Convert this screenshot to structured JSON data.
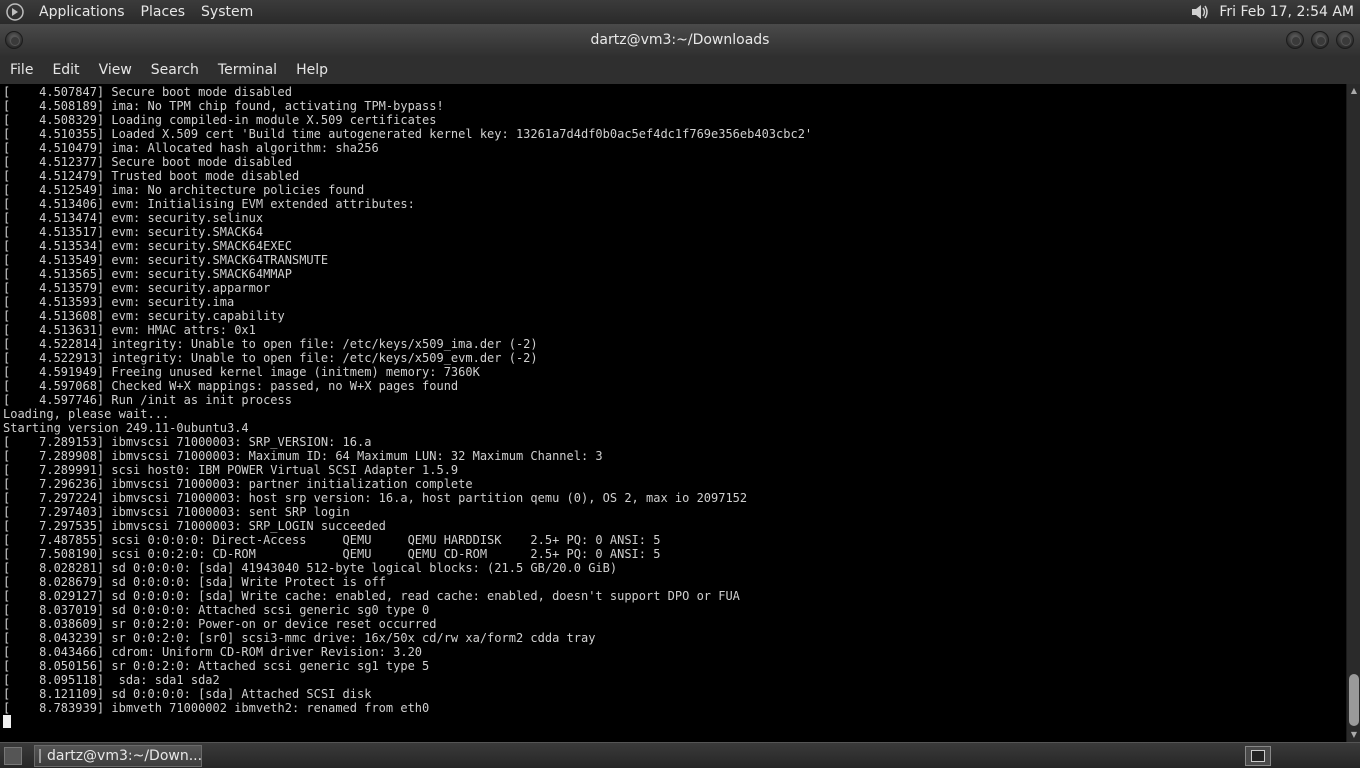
{
  "top_panel": {
    "menus": [
      "Applications",
      "Places",
      "System"
    ],
    "clock": "Fri Feb 17,  2:54 AM"
  },
  "window": {
    "title": "dartz@vm3:~/Downloads"
  },
  "menubar": {
    "items": [
      "File",
      "Edit",
      "View",
      "Search",
      "Terminal",
      "Help"
    ]
  },
  "terminal": {
    "lines": [
      "[    4.507847] Secure boot mode disabled",
      "[    4.508189] ima: No TPM chip found, activating TPM-bypass!",
      "[    4.508329] Loading compiled-in module X.509 certificates",
      "[    4.510355] Loaded X.509 cert 'Build time autogenerated kernel key: 13261a7d4df0b0ac5ef4dc1f769e356eb403cbc2'",
      "[    4.510479] ima: Allocated hash algorithm: sha256",
      "[    4.512377] Secure boot mode disabled",
      "[    4.512479] Trusted boot mode disabled",
      "[    4.512549] ima: No architecture policies found",
      "[    4.513406] evm: Initialising EVM extended attributes:",
      "[    4.513474] evm: security.selinux",
      "[    4.513517] evm: security.SMACK64",
      "[    4.513534] evm: security.SMACK64EXEC",
      "[    4.513549] evm: security.SMACK64TRANSMUTE",
      "[    4.513565] evm: security.SMACK64MMAP",
      "[    4.513579] evm: security.apparmor",
      "[    4.513593] evm: security.ima",
      "[    4.513608] evm: security.capability",
      "[    4.513631] evm: HMAC attrs: 0x1",
      "[    4.522814] integrity: Unable to open file: /etc/keys/x509_ima.der (-2)",
      "[    4.522913] integrity: Unable to open file: /etc/keys/x509_evm.der (-2)",
      "[    4.591949] Freeing unused kernel image (initmem) memory: 7360K",
      "[    4.597068] Checked W+X mappings: passed, no W+X pages found",
      "[    4.597746] Run /init as init process",
      "Loading, please wait...",
      "Starting version 249.11-0ubuntu3.4",
      "[    7.289153] ibmvscsi 71000003: SRP_VERSION: 16.a",
      "[    7.289908] ibmvscsi 71000003: Maximum ID: 64 Maximum LUN: 32 Maximum Channel: 3",
      "[    7.289991] scsi host0: IBM POWER Virtual SCSI Adapter 1.5.9",
      "[    7.296236] ibmvscsi 71000003: partner initialization complete",
      "[    7.297224] ibmvscsi 71000003: host srp version: 16.a, host partition qemu (0), OS 2, max io 2097152",
      "[    7.297403] ibmvscsi 71000003: sent SRP login",
      "[    7.297535] ibmvscsi 71000003: SRP_LOGIN succeeded",
      "[    7.487855] scsi 0:0:0:0: Direct-Access     QEMU     QEMU HARDDISK    2.5+ PQ: 0 ANSI: 5",
      "[    7.508190] scsi 0:0:2:0: CD-ROM            QEMU     QEMU CD-ROM      2.5+ PQ: 0 ANSI: 5",
      "[    8.028281] sd 0:0:0:0: [sda] 41943040 512-byte logical blocks: (21.5 GB/20.0 GiB)",
      "[    8.028679] sd 0:0:0:0: [sda] Write Protect is off",
      "[    8.029127] sd 0:0:0:0: [sda] Write cache: enabled, read cache: enabled, doesn't support DPO or FUA",
      "[    8.037019] sd 0:0:0:0: Attached scsi generic sg0 type 0",
      "[    8.038609] sr 0:0:2:0: Power-on or device reset occurred",
      "[    8.043239] sr 0:0:2:0: [sr0] scsi3-mmc drive: 16x/50x cd/rw xa/form2 cdda tray",
      "[    8.043466] cdrom: Uniform CD-ROM driver Revision: 3.20",
      "[    8.050156] sr 0:0:2:0: Attached scsi generic sg1 type 5",
      "[    8.095118]  sda: sda1 sda2",
      "[    8.121109] sd 0:0:0:0: [sda] Attached SCSI disk",
      "[    8.783939] ibmveth 71000002 ibmveth2: renamed from eth0"
    ]
  },
  "taskbar": {
    "task_label": "dartz@vm3:~/Down..."
  },
  "icons": {
    "logo": "distro-logo-icon",
    "volume": "speaker-volume-icon",
    "show_desktop": "show-desktop-icon",
    "task": "terminal-icon",
    "workspace": "workspace-switcher-icon"
  },
  "colors": {
    "terminal_bg": "#000000",
    "terminal_fg": "#d0d0d0",
    "panel_bg": "#2f2f2f"
  }
}
